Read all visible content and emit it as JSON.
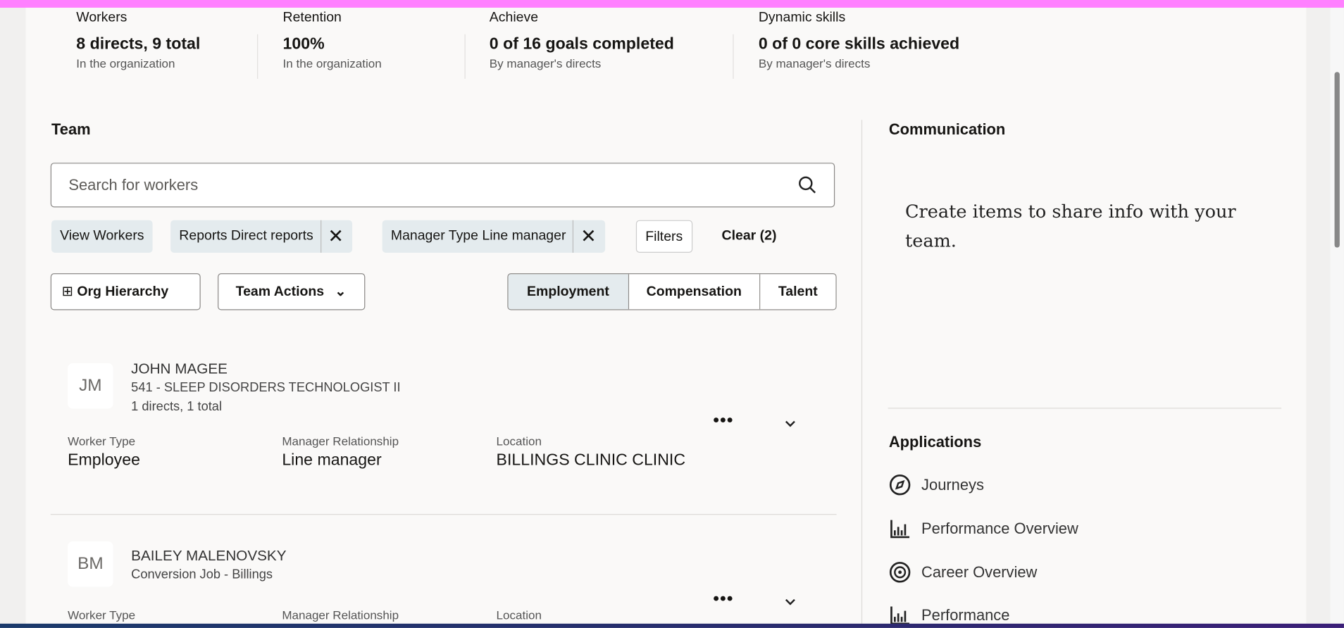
{
  "metrics": [
    {
      "label": "Workers",
      "value": "8 directs, 9 total",
      "sub": "In the organization"
    },
    {
      "label": "Retention",
      "value": "100%",
      "sub": "In the organization"
    },
    {
      "label": "Achieve",
      "value": "0 of 16 goals completed",
      "sub": "By manager's directs"
    },
    {
      "label": "Dynamic skills",
      "value": "0 of 0 core skills achieved",
      "sub": "By manager's directs"
    }
  ],
  "team": {
    "title": "Team",
    "search_placeholder": "Search for workers",
    "chips": [
      "View Workers",
      "Reports Direct reports",
      "Manager Type Line manager"
    ],
    "filters": "Filters",
    "clear": "Clear (2)",
    "org_hierarchy": "Org Hierarchy",
    "team_actions": "Team Actions",
    "views": [
      "Employment",
      "Compensation",
      "Talent"
    ],
    "field_labels": [
      "Worker Type",
      "Manager Relationship",
      "Location"
    ],
    "workers": [
      {
        "initials": "JM",
        "name": "JOHN MAGEE",
        "job": "541 - SLEEP DISORDERS TECHNOLOGIST II",
        "reports": "1 directs, 1 total",
        "worker_type": "Employee",
        "manager_relationship": "Line manager",
        "location": "BILLINGS CLINIC CLINIC"
      },
      {
        "initials": "BM",
        "name": "BAILEY MALENOVSKY",
        "job": "Conversion Job - Billings"
      }
    ]
  },
  "communication": {
    "title": "Communication",
    "empty": "Create items to share info with your team."
  },
  "applications": {
    "title": "Applications",
    "items": [
      "Journeys",
      "Performance Overview",
      "Career Overview",
      "Performance"
    ]
  }
}
